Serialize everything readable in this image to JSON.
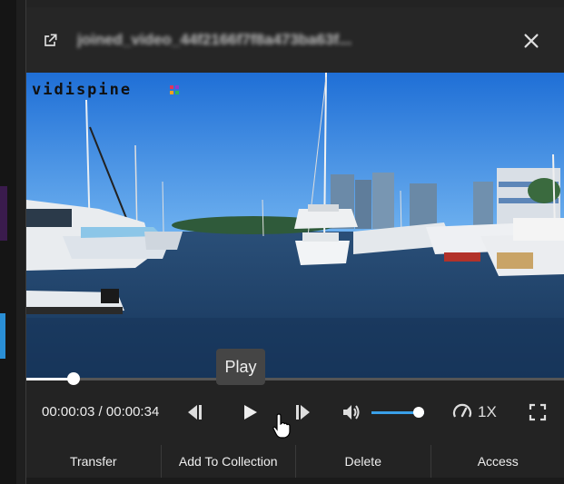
{
  "header": {
    "title": "joined_video_44f2166f7f8a473ba63f...",
    "open_icon": "open-in-new-icon",
    "close_icon": "close-icon"
  },
  "player": {
    "watermark": "vidispine",
    "time_display": "00:00:03 / 00:00:34",
    "current_time": "00:00:03",
    "duration": "00:00:34",
    "progress_fraction": 0.088,
    "volume_fraction": 0.9,
    "tooltip": "Play",
    "speed_label": "1X",
    "icons": {
      "prev": "skip-previous-icon",
      "play": "play-icon",
      "next": "skip-next-icon",
      "volume": "volume-icon",
      "speed": "speedometer-icon",
      "fullscreen": "fullscreen-icon"
    }
  },
  "actions": {
    "transfer": "Transfer",
    "add_to_collection": "Add To Collection",
    "delete": "Delete",
    "access": "Access"
  },
  "colors": {
    "panel_bg": "#232323",
    "accent_blue": "#3aa0e8",
    "text": "#eeeeee"
  }
}
